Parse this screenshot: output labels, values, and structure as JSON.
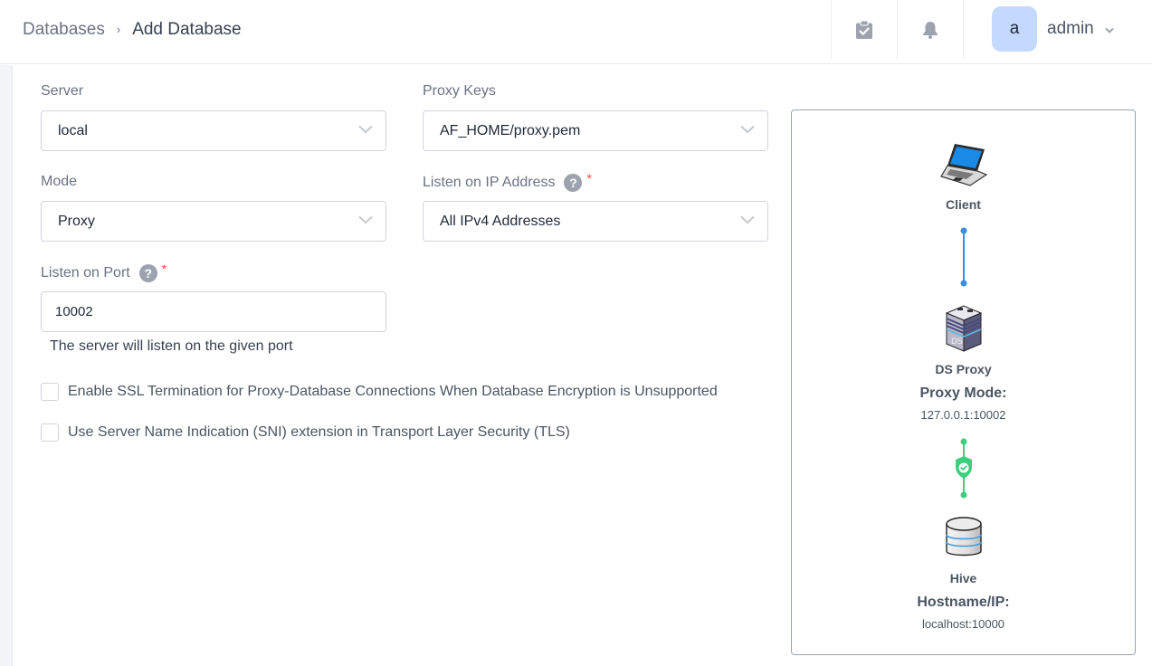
{
  "header": {
    "breadcrumb": {
      "parent": "Databases",
      "separator": "›",
      "current": "Add Database"
    },
    "icons": {
      "tasks": "clipboard-check-icon",
      "notifications": "bell-icon",
      "user_menu": "chevron-down-icon"
    },
    "user": {
      "avatar_letter": "a",
      "name": "admin"
    }
  },
  "form": {
    "server": {
      "label": "Server",
      "value": "local"
    },
    "proxy_keys": {
      "label": "Proxy Keys",
      "value": "AF_HOME/proxy.pem"
    },
    "mode": {
      "label": "Mode",
      "value": "Proxy"
    },
    "listen_ip": {
      "label": "Listen on IP Address",
      "help": "?",
      "required_mark": "*",
      "value": "All IPv4 Addresses"
    },
    "listen_port": {
      "label": "Listen on Port",
      "help": "?",
      "required_mark": "*",
      "value": "10002",
      "hint": "The server will listen on the given port"
    },
    "checkboxes": [
      {
        "label": "Enable SSL Termination for Proxy-Database Connections When Database Encryption is Unsupported",
        "checked": false
      },
      {
        "label": "Use Server Name Indication (SNI) extension in Transport Layer Security (TLS)",
        "checked": false
      }
    ]
  },
  "diagram": {
    "client": {
      "icon": "laptop-icon",
      "name": "Client"
    },
    "proxy": {
      "icon": "ds-proxy-server-icon",
      "name": "DS Proxy",
      "mode_label": "Proxy Mode:",
      "address": "127.0.0.1:10002"
    },
    "database": {
      "icon": "database-icon",
      "name": "Hive",
      "host_label": "Hostname/IP:",
      "address": "localhost:10000"
    },
    "links": [
      {
        "from": "client",
        "to": "proxy",
        "secure": false,
        "color": "#3b8fe0"
      },
      {
        "from": "proxy",
        "to": "database",
        "secure": true,
        "color": "#3ccf7e"
      }
    ]
  },
  "colors": {
    "accent_blue": "#3b8fe0",
    "secure_green": "#3ccf7e",
    "avatar_bg": "#c3dafe",
    "required_red": "#ef4444"
  }
}
